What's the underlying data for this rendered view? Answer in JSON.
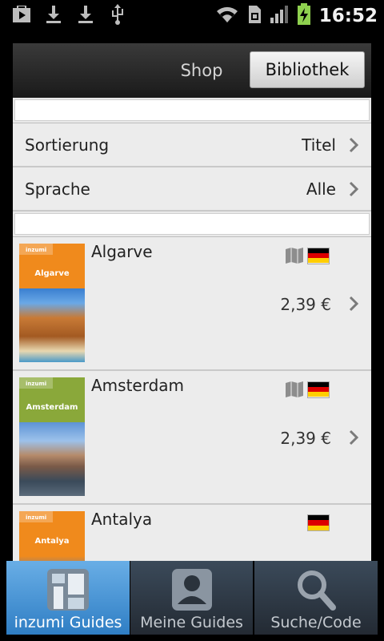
{
  "status_bar": {
    "time": "16:52",
    "icons": [
      "play-store-icon",
      "download-icon",
      "download-icon",
      "usb-icon",
      "wifi-icon",
      "sim-icon",
      "signal-icon",
      "battery-charging-icon"
    ]
  },
  "header": {
    "tabs": [
      {
        "label": "Shop",
        "selected": false
      },
      {
        "label": "Bibliothek",
        "selected": true
      }
    ]
  },
  "filters": [
    {
      "label": "Sortierung",
      "value": "Titel"
    },
    {
      "label": "Sprache",
      "value": "Alle"
    }
  ],
  "guides": [
    {
      "title": "Algarve",
      "cover_title": "Algarve",
      "cover_color": "#f08a1c",
      "price": "2,39 €",
      "has_map": true,
      "language_flag": "de"
    },
    {
      "title": "Amsterdam",
      "cover_title": "Amsterdam",
      "cover_color": "#8aa83a",
      "price": "2,39 €",
      "has_map": true,
      "language_flag": "de"
    },
    {
      "title": "Antalya",
      "cover_title": "Antalya",
      "cover_color": "#f08a1c",
      "price": "",
      "has_map": false,
      "language_flag": "de"
    }
  ],
  "cover_brand": "inzumi",
  "bottom_tabs": [
    {
      "label": "inzumi Guides",
      "icon": "inzumi-guides-icon",
      "selected": true
    },
    {
      "label": "Meine Guides",
      "icon": "person-icon",
      "selected": false
    },
    {
      "label": "Suche/Code",
      "icon": "search-icon",
      "selected": false
    }
  ],
  "colors": {
    "accent": "#3d8bd2",
    "flag_black": "#000000",
    "flag_red": "#dd0000",
    "flag_gold": "#ffce00"
  }
}
